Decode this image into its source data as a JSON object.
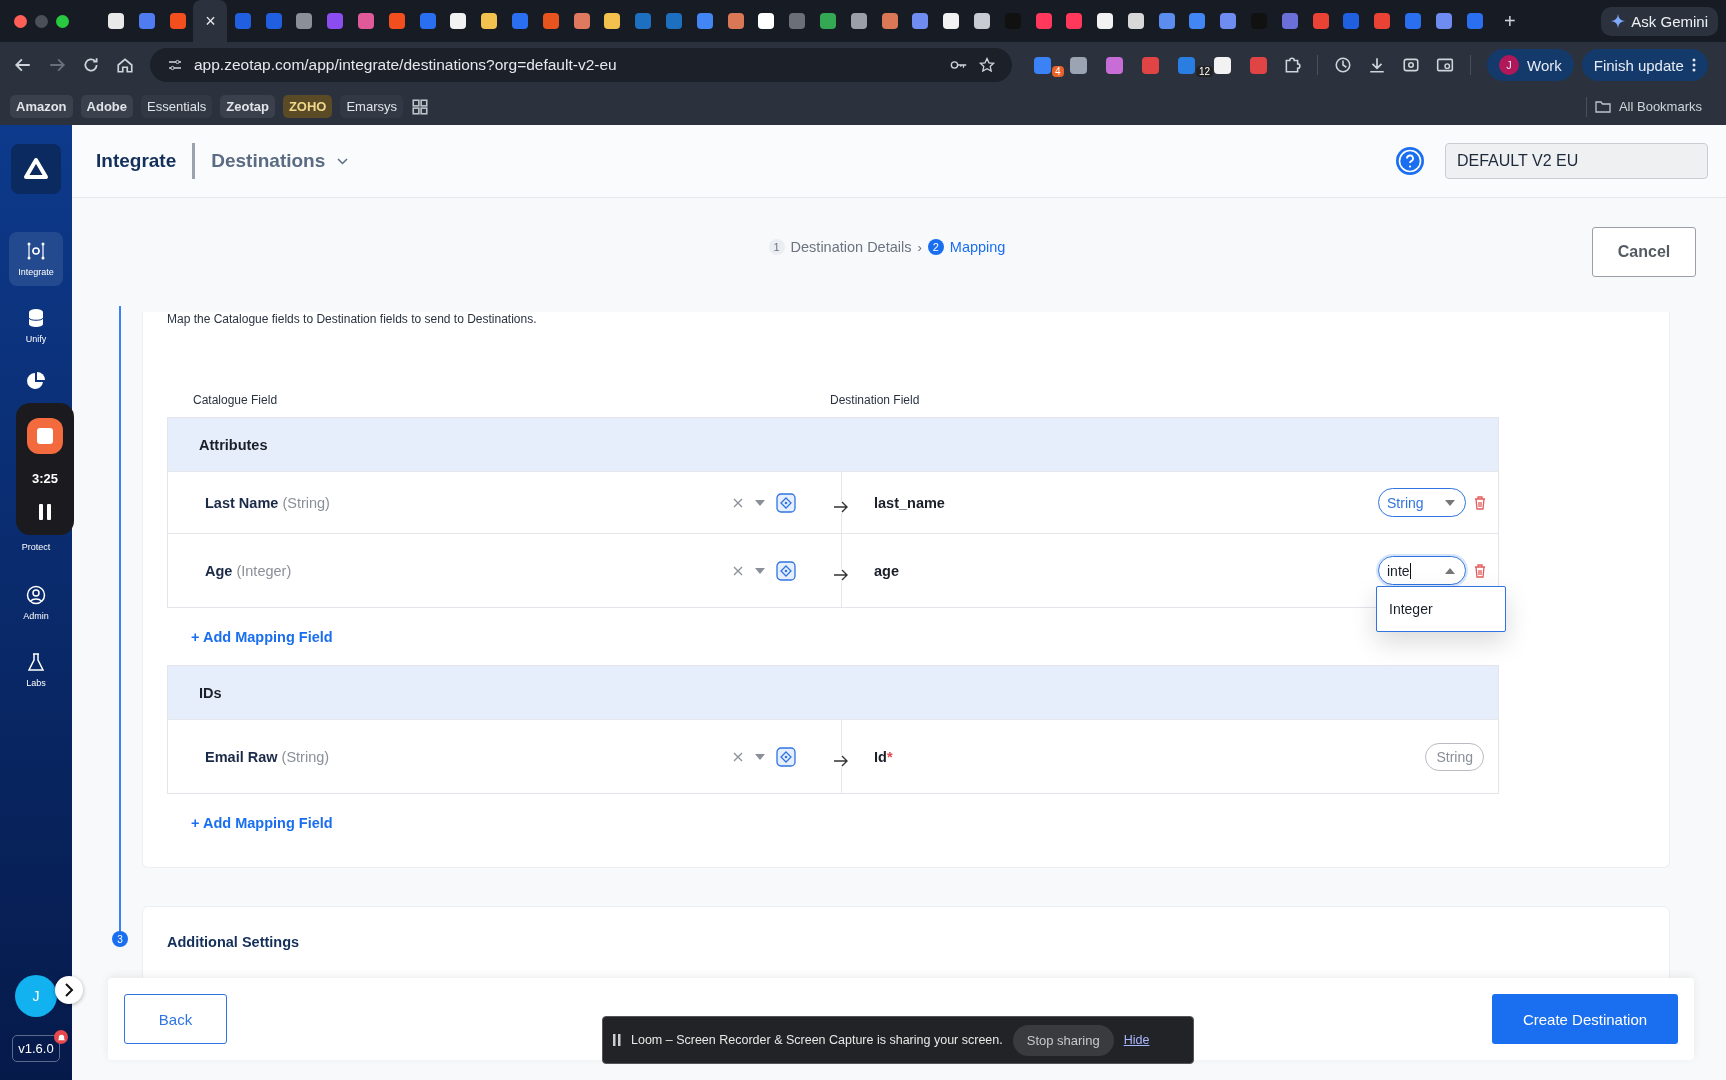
{
  "browser": {
    "tabs": [
      {
        "color": "#e8e8e8",
        "selected": false
      },
      {
        "color": "#4f7cf0",
        "selected": false
      },
      {
        "color": "#f24e1e",
        "selected": false
      },
      {
        "selected": true,
        "close": "×"
      },
      {
        "color": "#1f5fe0",
        "selected": false
      },
      {
        "color": "#1f5fe0",
        "selected": false
      },
      {
        "color": "#8a8f98",
        "selected": false
      },
      {
        "color": "#8b4cf0",
        "selected": false
      },
      {
        "color": "#e05a9a",
        "selected": false
      },
      {
        "color": "#f24e1e",
        "selected": false
      },
      {
        "color": "#2a6ff0",
        "selected": false
      },
      {
        "color": "#f2f2f2",
        "selected": false
      },
      {
        "color": "#f2c14e",
        "selected": false
      },
      {
        "color": "#2a6ff0",
        "selected": false
      },
      {
        "color": "#e8541e",
        "selected": false
      },
      {
        "color": "#e07a5f",
        "selected": false
      },
      {
        "color": "#f2c14e",
        "selected": false
      },
      {
        "color": "#1d6fc0",
        "selected": false
      },
      {
        "color": "#1d6fc0",
        "selected": false
      },
      {
        "color": "#4285f4",
        "selected": false
      },
      {
        "color": "#d97757",
        "selected": false
      },
      {
        "color": "#ffffff",
        "selected": false
      },
      {
        "color": "#6a6f78",
        "selected": false
      },
      {
        "color": "#34a853",
        "selected": false
      },
      {
        "color": "#9aa0a6",
        "selected": false
      },
      {
        "color": "#d97757",
        "selected": false
      },
      {
        "color": "#6f8cf0",
        "selected": false
      },
      {
        "color": "#f2f2f2",
        "selected": false
      },
      {
        "color": "#c8ccd2",
        "selected": false
      },
      {
        "color": "#111111",
        "selected": false
      },
      {
        "color": "#ff385c",
        "selected": false
      },
      {
        "color": "#ff385c",
        "selected": false
      },
      {
        "color": "#f2f2f2",
        "selected": false
      },
      {
        "color": "#d8d8d8",
        "selected": false
      },
      {
        "color": "#5b8def",
        "selected": false
      },
      {
        "color": "#4285f4",
        "selected": false
      },
      {
        "color": "#6f8cf0",
        "selected": false
      },
      {
        "color": "#111111",
        "selected": false
      },
      {
        "color": "#6b6fd8",
        "selected": false
      },
      {
        "color": "#ea4335",
        "selected": false
      },
      {
        "color": "#1f5fe0",
        "selected": false
      },
      {
        "color": "#ea4335",
        "selected": false
      },
      {
        "color": "#2a6ff0",
        "selected": false
      },
      {
        "color": "#6f8cf0",
        "selected": false
      },
      {
        "color": "#2a6ff0",
        "selected": false
      }
    ],
    "new_tab": "+",
    "gemini": "Ask Gemini",
    "url": "app.zeotap.com/app/integrate/destinations?org=default-v2-eu",
    "extensions": [
      {
        "color": "#3b82f6",
        "badge": "4"
      },
      {
        "color": "#9aa4b2"
      },
      {
        "color": "#c86dd7"
      },
      {
        "color": "#e04444"
      },
      {
        "color": "#2a7de1",
        "badge": "12"
      },
      {
        "color": "#f2f2f2"
      },
      {
        "color": "#e04444"
      }
    ],
    "profile": {
      "initial": "J",
      "label": "Work"
    },
    "update": "Finish update",
    "bookmarks": [
      "Amazon",
      "Adobe",
      "Essentials",
      "Zeotap",
      "ZOHO",
      "Emarsys"
    ],
    "all_bookmarks": "All Bookmarks"
  },
  "sidebar": {
    "items": [
      {
        "label": "Integrate",
        "selected": true,
        "kind": "integrate"
      },
      {
        "label": "Unify",
        "selected": false,
        "kind": "unify"
      },
      {
        "selected": false,
        "kind": "pie"
      },
      {
        "label": "Protect",
        "selected": false,
        "kind": "protect"
      },
      {
        "label": "Admin",
        "selected": false,
        "kind": "admin"
      },
      {
        "label": "Labs",
        "selected": false,
        "kind": "labs"
      }
    ],
    "avatar": "J",
    "version": "v1.6.0"
  },
  "recorder": {
    "time": "3:25"
  },
  "header": {
    "title": "Integrate",
    "section": "Destinations",
    "org": "DEFAULT V2 EU"
  },
  "steps": [
    {
      "number": "1",
      "label": "Destination Details",
      "selected": false
    },
    {
      "number": "2",
      "label": "Mapping",
      "selected": true
    }
  ],
  "step_separator": "›",
  "cancel": "Cancel",
  "mapping": {
    "description": "Map the Catalogue fields to Destination fields to send to Destinations.",
    "columns": [
      "Catalogue Field",
      "Destination Field"
    ],
    "groups": [
      {
        "title": "Attributes",
        "rows": [
          {
            "source": "Last Name",
            "source_type": "(String)",
            "target": "last_name",
            "type": {
              "kind": "select",
              "value": "String"
            }
          },
          {
            "source": "Age",
            "source_type": "(Integer)",
            "target": "age",
            "type": {
              "kind": "input",
              "value": "inte",
              "open": true,
              "options": [
                "Integer"
              ]
            }
          }
        ],
        "add": "+ Add Mapping Field"
      },
      {
        "title": "IDs",
        "rows": [
          {
            "source": "Email Raw",
            "source_type": "(String)",
            "target": "Id",
            "required_mark": "*",
            "type": {
              "kind": "tag",
              "value": "String"
            }
          }
        ],
        "add": "+ Add Mapping Field"
      }
    ]
  },
  "additional": {
    "number": "3",
    "title": "Additional Settings"
  },
  "footer": {
    "back": "Back",
    "create": "Create Destination"
  },
  "share_bar": {
    "text": "Loom – Screen Recorder & Screen Capture is sharing your screen.",
    "stop": "Stop sharing",
    "hide": "Hide"
  }
}
